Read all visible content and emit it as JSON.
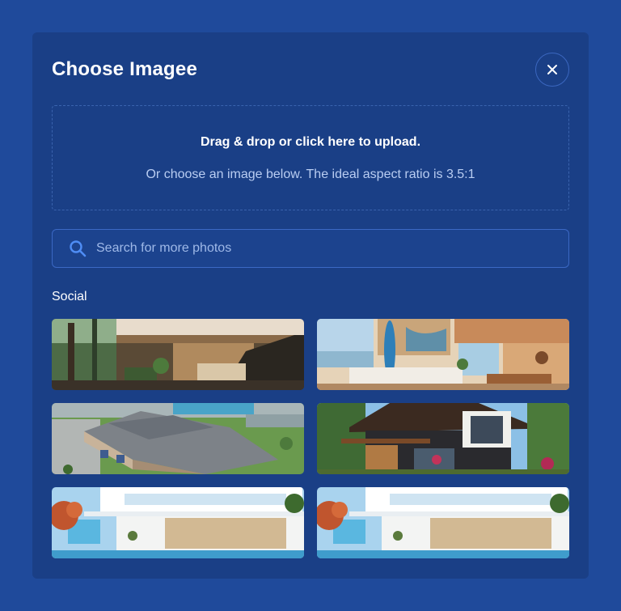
{
  "modal": {
    "title": "Choose Imagee",
    "close_icon": "close-icon"
  },
  "dropzone": {
    "primary_text": "Drag & drop or click here to upload.",
    "secondary_text": "Or choose an image below. The ideal aspect ratio is 3.5:1"
  },
  "search": {
    "placeholder": "Search for more photos",
    "value": "",
    "icon": "search-icon"
  },
  "gallery": {
    "section_label": "Social",
    "images": [
      {
        "name": "modern-interior-staircase"
      },
      {
        "name": "beach-house-living-room"
      },
      {
        "name": "aerial-apartment-complex"
      },
      {
        "name": "modern-wooden-villa"
      },
      {
        "name": "white-villa-pool"
      },
      {
        "name": "white-villa-pool-copy"
      }
    ]
  },
  "colors": {
    "page_bg": "#1f4a9b",
    "modal_bg": "#1a3f86",
    "accent": "#4f8df5"
  }
}
